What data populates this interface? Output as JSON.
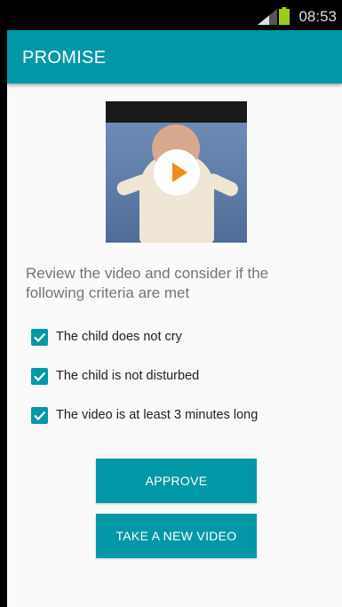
{
  "status_bar": {
    "time": "08:53",
    "signal_icon": "signal-icon",
    "battery_icon": "battery-icon"
  },
  "app_bar": {
    "title": "PROMISE"
  },
  "video": {
    "play_icon": "play-icon"
  },
  "instructions": "Review the video and consider if the following criteria are met",
  "criteria": [
    {
      "label": "The child does not cry",
      "checked": true
    },
    {
      "label": "The child is not disturbed",
      "checked": true
    },
    {
      "label": "The video is at least 3 minutes long",
      "checked": true
    }
  ],
  "buttons": {
    "approve": "APPROVE",
    "retake": "TAKE A NEW VIDEO"
  },
  "colors": {
    "accent": "#0097a7",
    "status_bar": "#000000",
    "battery": "#9ccc1a"
  }
}
